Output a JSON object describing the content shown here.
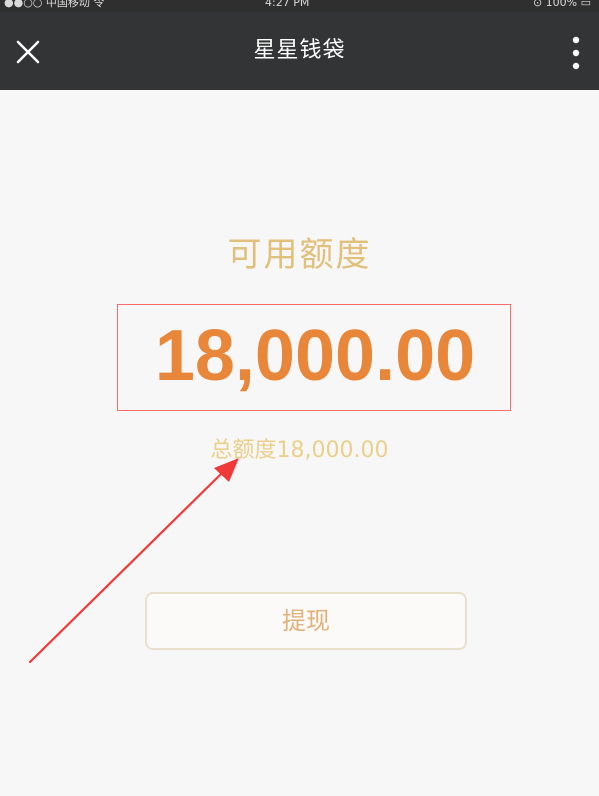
{
  "status_bar": {
    "carrier": "●●○○ 中国移动 令",
    "time": "4:27 PM",
    "battery": "⊙ 100% ▭"
  },
  "nav": {
    "title": "星星钱袋",
    "close_icon": "close-icon",
    "more_icon": "more-vertical-icon"
  },
  "wallet": {
    "available_label": "可用额度",
    "available_amount": "18,000.00",
    "total_quota": "总额度18,000.00",
    "withdraw_label": "提现"
  },
  "annotation": {
    "highlight_color": "#ff6a6a",
    "arrow_color": "#f03a3a"
  }
}
